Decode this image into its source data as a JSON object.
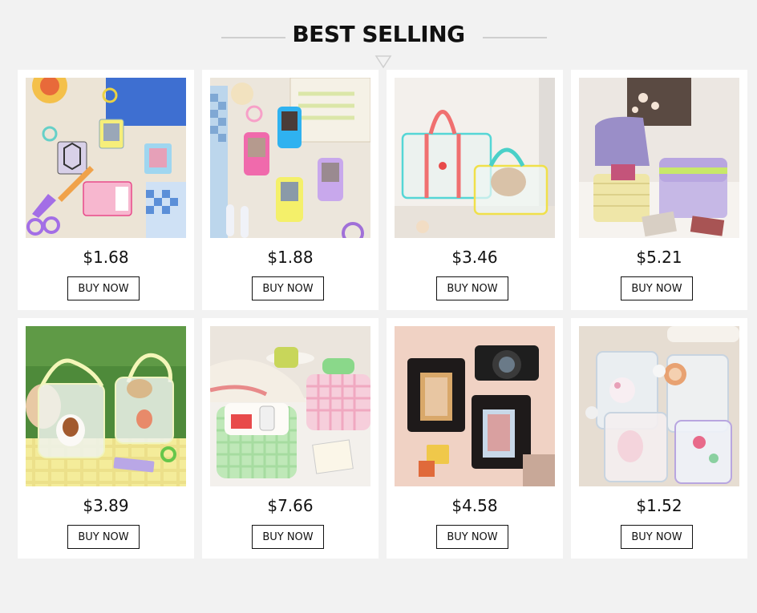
{
  "section": {
    "title": "BEST SELLING",
    "indicator_icon": "triangle-down-icon"
  },
  "products": [
    {
      "price": "$1.68",
      "button": "BUY NOW",
      "image": "photocard-keychains-photo"
    },
    {
      "price": "$1.88",
      "button": "BUY NOW",
      "image": "phone-shaped-photocard-holders-photo"
    },
    {
      "price": "$3.46",
      "button": "BUY NOW",
      "image": "clear-tote-bags-photo"
    },
    {
      "price": "$5.21",
      "button": "BUY NOW",
      "image": "quilted-makeup-cases-photo"
    },
    {
      "price": "$3.89",
      "button": "BUY NOW",
      "image": "mesh-bear-bags-photo"
    },
    {
      "price": "$7.66",
      "button": "BUY NOW",
      "image": "gingham-cosmetic-bags-photo"
    },
    {
      "price": "$4.58",
      "button": "BUY NOW",
      "image": "photo-albums-camera-photo"
    },
    {
      "price": "$1.52",
      "button": "BUY NOW",
      "image": "cute-binders-photo"
    }
  ]
}
